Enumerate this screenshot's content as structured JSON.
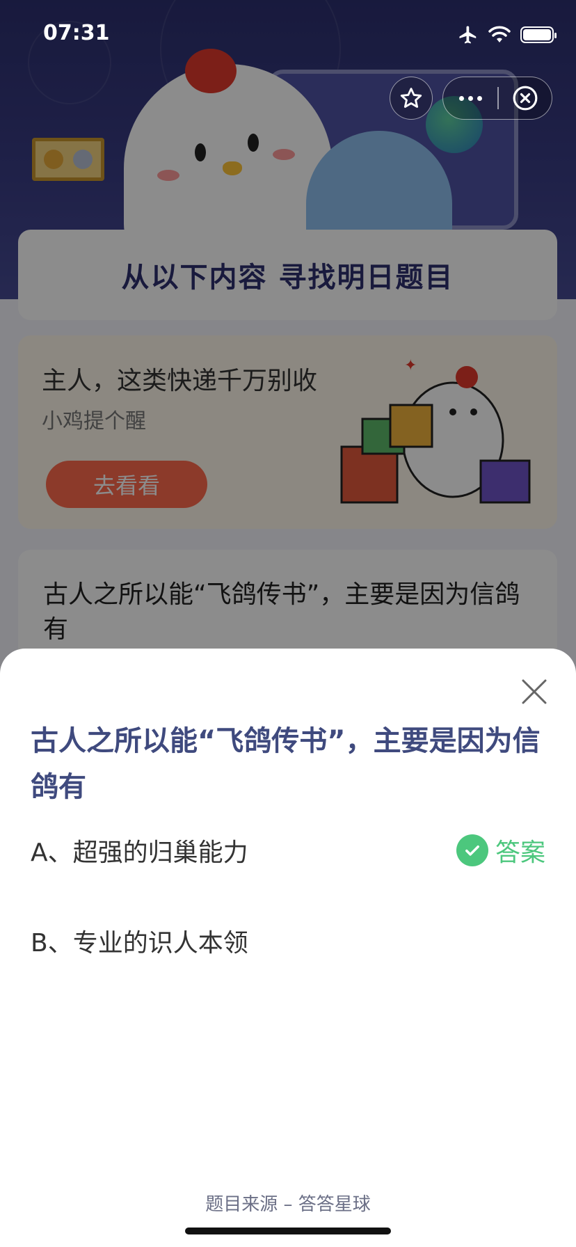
{
  "status_bar": {
    "time": "07:31"
  },
  "background": {
    "section_title": "从以下内容 寻找明日题目",
    "promo": {
      "title": "主人，这类快递千万别收",
      "subtitle": "小鸡提个醒",
      "button_label": "去看看"
    },
    "question_card": {
      "text": "古人之所以能“飞鸽传书”，主要是因为信鸽有"
    }
  },
  "sheet": {
    "question": "古人之所以能“飞鸽传书”，主要是因为信鸽有",
    "options": [
      {
        "label": "A、超强的归巢能力",
        "is_answer": true
      },
      {
        "label": "B、专业的识人本领",
        "is_answer": false
      }
    ],
    "answer_label": "答案",
    "source": "题目来源 – 答答星球"
  },
  "colors": {
    "accent": "#4cc77d",
    "question_text": "#3f4a7e",
    "promo_button": "#ff6a4d"
  }
}
